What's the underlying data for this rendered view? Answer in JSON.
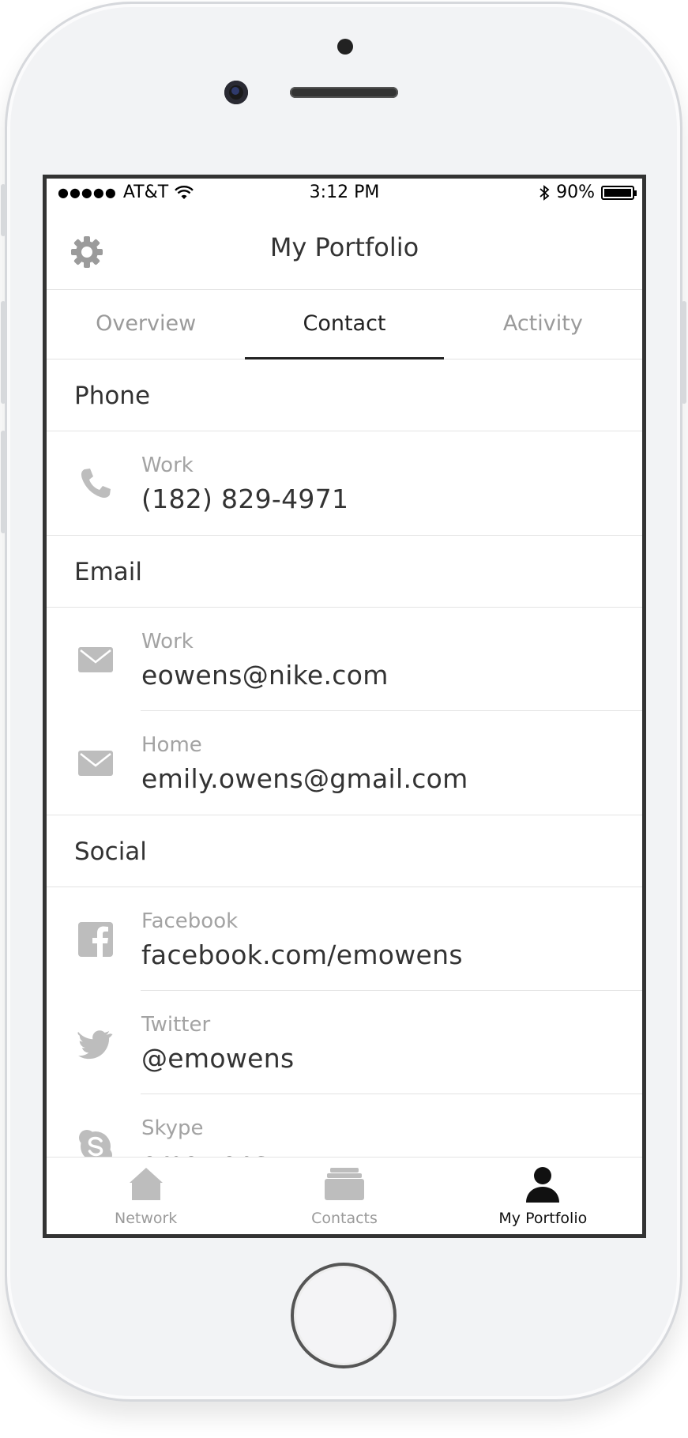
{
  "status_bar": {
    "signal": "●●●●●",
    "carrier": "AT&T",
    "time": "3:12 PM",
    "battery_percent": "90%",
    "battery_level": 0.9
  },
  "navbar": {
    "title": "My Portfolio"
  },
  "tabs": [
    {
      "label": "Overview",
      "active": false
    },
    {
      "label": "Contact",
      "active": true
    },
    {
      "label": "Activity",
      "active": false
    }
  ],
  "sections": {
    "phone": {
      "title": "Phone",
      "items": [
        {
          "label": "Work",
          "value": "(182) 829-4971",
          "icon": "phone-icon"
        }
      ]
    },
    "email": {
      "title": "Email",
      "items": [
        {
          "label": "Work",
          "value": "eowens@nike.com",
          "icon": "mail-icon"
        },
        {
          "label": "Home",
          "value": "emily.owens@gmail.com",
          "icon": "mail-icon"
        }
      ]
    },
    "social": {
      "title": "Social",
      "items": [
        {
          "label": "Facebook",
          "value": "facebook.com/emowens",
          "icon": "facebook-icon"
        },
        {
          "label": "Twitter",
          "value": "@emowens",
          "icon": "twitter-icon"
        },
        {
          "label": "Skype",
          "value": "emowens",
          "icon": "skype-icon"
        }
      ]
    }
  },
  "tabbar": [
    {
      "label": "Network",
      "icon": "home-icon",
      "active": false
    },
    {
      "label": "Contacts",
      "icon": "contacts-icon",
      "active": false
    },
    {
      "label": "My Portfolio",
      "icon": "person-icon",
      "active": true
    }
  ],
  "colors": {
    "icon_gray": "#bdbdbd",
    "active_text": "#222222",
    "inactive_text": "#9a9a9a"
  }
}
